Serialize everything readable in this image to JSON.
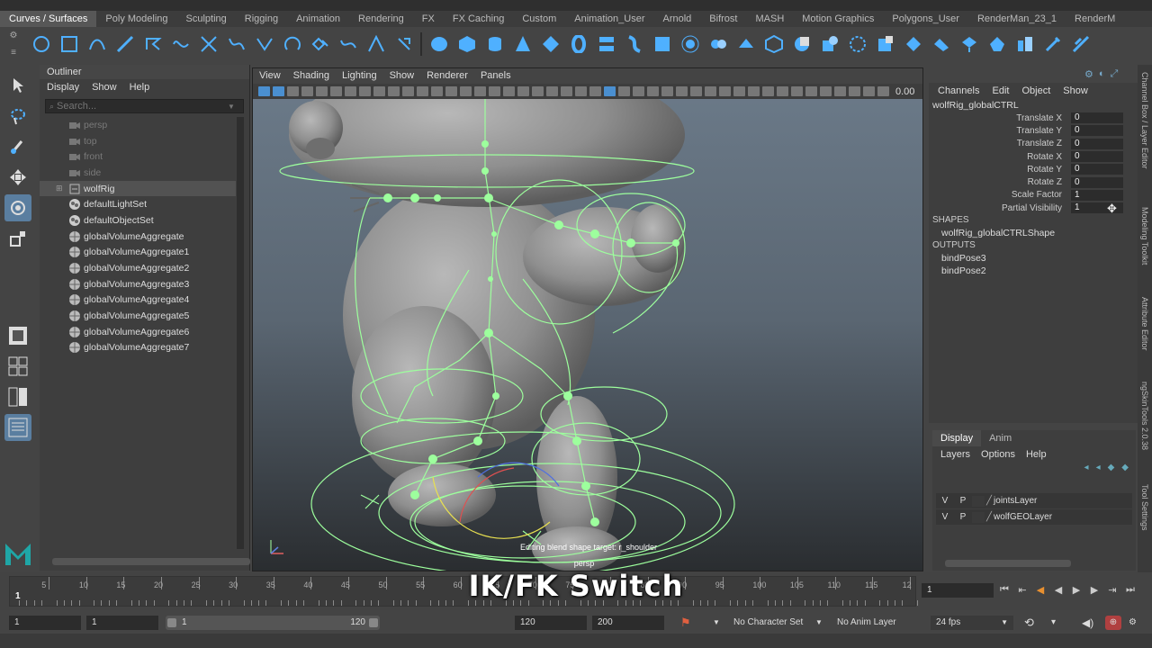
{
  "shelf_tabs": [
    "Curves / Surfaces",
    "Poly Modeling",
    "Sculpting",
    "Rigging",
    "Animation",
    "Rendering",
    "FX",
    "FX Caching",
    "Custom",
    "Animation_User",
    "Arnold",
    "Bifrost",
    "MASH",
    "Motion Graphics",
    "Polygons_User",
    "RenderMan_23_1",
    "RenderM"
  ],
  "outliner": {
    "title": "Outliner",
    "menu": [
      "Display",
      "Show",
      "Help"
    ],
    "search_placeholder": "Search...",
    "items": [
      {
        "label": "persp",
        "icon": "camera-icon",
        "dim": true
      },
      {
        "label": "top",
        "icon": "camera-icon",
        "dim": true
      },
      {
        "label": "front",
        "icon": "camera-icon",
        "dim": true
      },
      {
        "label": "side",
        "icon": "camera-icon",
        "dim": true
      },
      {
        "label": "wolfRig",
        "icon": "transform-group-icon",
        "dim": false,
        "expandable": true,
        "selected": true
      },
      {
        "label": "defaultLightSet",
        "icon": "set-icon",
        "dim": false
      },
      {
        "label": "defaultObjectSet",
        "icon": "set-icon",
        "dim": false
      },
      {
        "label": "globalVolumeAggregate",
        "icon": "sphere-icon",
        "dim": false
      },
      {
        "label": "globalVolumeAggregate1",
        "icon": "sphere-icon",
        "dim": false
      },
      {
        "label": "globalVolumeAggregate2",
        "icon": "sphere-icon",
        "dim": false
      },
      {
        "label": "globalVolumeAggregate3",
        "icon": "sphere-icon",
        "dim": false
      },
      {
        "label": "globalVolumeAggregate4",
        "icon": "sphere-icon",
        "dim": false
      },
      {
        "label": "globalVolumeAggregate5",
        "icon": "sphere-icon",
        "dim": false
      },
      {
        "label": "globalVolumeAggregate6",
        "icon": "sphere-icon",
        "dim": false
      },
      {
        "label": "globalVolumeAggregate7",
        "icon": "sphere-icon",
        "dim": false
      }
    ]
  },
  "viewport": {
    "menu": [
      "View",
      "Shading",
      "Lighting",
      "Show",
      "Renderer",
      "Panels"
    ],
    "value_readout": "0.00",
    "status_text": "Editing blend shape target: r_shoulder",
    "camera_label": "persp"
  },
  "channel_box": {
    "menu": [
      "Channels",
      "Edit",
      "Object",
      "Show"
    ],
    "node": "wolfRig_globalCTRL",
    "attributes": [
      {
        "name": "Translate X",
        "value": "0"
      },
      {
        "name": "Translate Y",
        "value": "0"
      },
      {
        "name": "Translate Z",
        "value": "0"
      },
      {
        "name": "Rotate X",
        "value": "0"
      },
      {
        "name": "Rotate Y",
        "value": "0"
      },
      {
        "name": "Rotate Z",
        "value": "0"
      },
      {
        "name": "Scale Factor",
        "value": "1"
      },
      {
        "name": "Partial Visibility",
        "value": "1"
      }
    ],
    "shapes_header": "SHAPES",
    "shapes": [
      "wolfRig_globalCTRLShape"
    ],
    "outputs_header": "OUTPUTS",
    "outputs": [
      "bindPose3",
      "bindPose2"
    ]
  },
  "right_strip_tabs": [
    "Channel Box / Layer Editor",
    "Modeling Toolkit",
    "Attribute Editor",
    "ngSkinTools 2.0.38",
    "Tool Settings"
  ],
  "layer_editor": {
    "tabs": [
      "Display",
      "Anim"
    ],
    "menu": [
      "Layers",
      "Options",
      "Help"
    ],
    "layers": [
      {
        "v": "V",
        "p": "P",
        "name": "jointsLayer"
      },
      {
        "v": "V",
        "p": "P",
        "name": "wolfGEOLayer"
      }
    ]
  },
  "timeline": {
    "ticks": [
      "5",
      "10",
      "15",
      "20",
      "25",
      "30",
      "35",
      "40",
      "45",
      "50",
      "55",
      "60",
      "65",
      "70",
      "75",
      "80",
      "85",
      "90",
      "95",
      "100",
      "105",
      "110",
      "115",
      "12"
    ],
    "current_frame_marker": "1",
    "current_frame": "1",
    "caption": "IK/FK Switch"
  },
  "range_bar": {
    "start": "1",
    "playback_start": "1",
    "slider_start": "1",
    "slider_end": "120",
    "playback_end": "120",
    "end": "200",
    "character_set": "No Character Set",
    "anim_layer": "No Anim Layer",
    "fps": "24 fps"
  },
  "colors": {
    "accent": "#5a7ea0",
    "rig_green": "#9dff9d",
    "logo_teal": "#1fa6a6"
  }
}
